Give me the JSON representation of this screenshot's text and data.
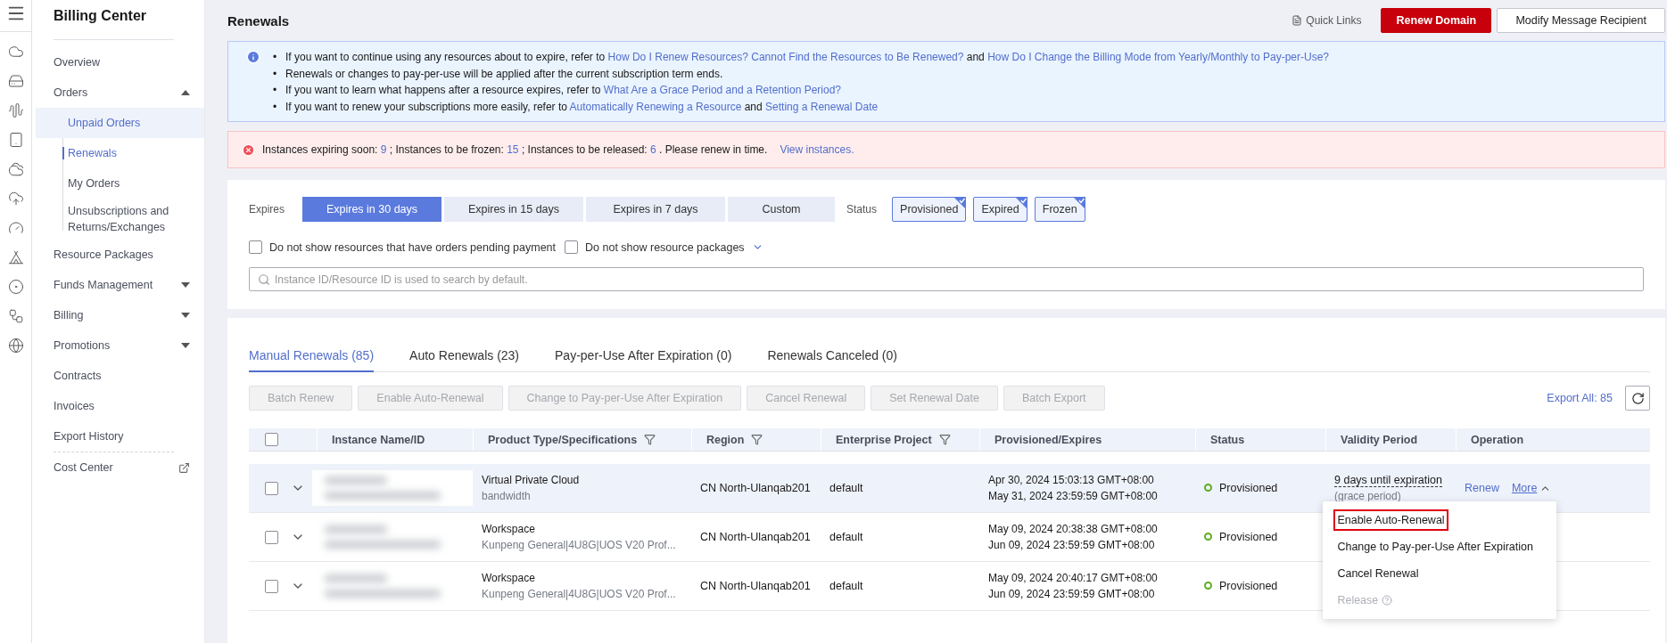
{
  "sidebar": {
    "title": "Billing Center",
    "items": [
      {
        "label": "Overview",
        "kind": "link"
      },
      {
        "label": "Orders",
        "kind": "group",
        "expanded": true,
        "children": [
          {
            "label": "Unpaid Orders",
            "selected": false,
            "hovered": true
          },
          {
            "label": "Renewals",
            "selected": true,
            "hovered": false
          },
          {
            "label": "My Orders",
            "selected": false,
            "hovered": false
          },
          {
            "label": "Unsubscriptions and Returns/Exchanges",
            "selected": false,
            "hovered": false
          }
        ]
      },
      {
        "label": "Resource Packages",
        "kind": "link"
      },
      {
        "label": "Funds Management",
        "kind": "group",
        "expanded": false
      },
      {
        "label": "Billing",
        "kind": "group",
        "expanded": false
      },
      {
        "label": "Promotions",
        "kind": "group",
        "expanded": false
      },
      {
        "label": "Contracts",
        "kind": "link"
      },
      {
        "label": "Invoices",
        "kind": "link"
      },
      {
        "label": "Export History",
        "kind": "link"
      },
      {
        "label": "Cost Center",
        "kind": "external"
      }
    ]
  },
  "page": {
    "title": "Renewals",
    "quick_links": "Quick Links",
    "buttons": [
      {
        "label": "Renew Domain",
        "kind": "primary"
      },
      {
        "label": "Modify Message Recipient",
        "kind": "default"
      }
    ]
  },
  "info": {
    "items": [
      {
        "marker": "•",
        "parts": [
          {
            "text": "If you want to continue using any resources about to expire, refer to ",
            "kind": "text"
          },
          {
            "text": "How Do I Renew Resources? Cannot Find the Resources to Be Renewed?",
            "kind": "link"
          },
          {
            "text": " and ",
            "kind": "text"
          },
          {
            "text": "How Do I Change the Billing Mode from Yearly/Monthly to Pay-per-Use?",
            "kind": "link"
          }
        ]
      },
      {
        "marker": "•",
        "parts": [
          {
            "text": "Renewals or changes to pay-per-use will be applied after the current subscription term ends.",
            "kind": "text"
          }
        ]
      },
      {
        "marker": "•",
        "parts": [
          {
            "text": "If you want to learn what happens after a resource expires, refer to ",
            "kind": "text"
          },
          {
            "text": "What Are a Grace Period and a Retention Period?",
            "kind": "link"
          }
        ]
      },
      {
        "marker": "•",
        "parts": [
          {
            "text": "If you want to renew your subscriptions more easily, refer to ",
            "kind": "text"
          },
          {
            "text": "Automatically Renewing a Resource",
            "kind": "link"
          },
          {
            "text": " and ",
            "kind": "text"
          },
          {
            "text": "Setting a Renewal Date",
            "kind": "link"
          }
        ]
      }
    ]
  },
  "alert": {
    "parts": [
      {
        "text": "Instances expiring soon: ",
        "kind": "text"
      },
      {
        "text": "9",
        "kind": "link"
      },
      {
        "text": " ; Instances to be frozen: ",
        "kind": "text"
      },
      {
        "text": "15",
        "kind": "link"
      },
      {
        "text": " ; Instances to be released: ",
        "kind": "text"
      },
      {
        "text": "6",
        "kind": "link"
      },
      {
        "text": " . Please renew in time.",
        "kind": "text"
      },
      {
        "text": "View instances.",
        "kind": "link"
      }
    ]
  },
  "filters": {
    "expires_label": "Expires",
    "expires_options": [
      {
        "label": "Expires in 30 days",
        "selected": true
      },
      {
        "label": "Expires in 15 days",
        "selected": false
      },
      {
        "label": "Expires in 7 days",
        "selected": false
      },
      {
        "label": "Custom",
        "selected": false
      }
    ],
    "status_label": "Status",
    "status_options": [
      {
        "label": "Provisioned",
        "checked": true
      },
      {
        "label": "Expired",
        "checked": true
      },
      {
        "label": "Frozen",
        "checked": true
      }
    ],
    "checkboxes": [
      {
        "label": "Do not show resources that have orders pending payment",
        "checked": false,
        "kind": "plain"
      },
      {
        "label": "Do not show resource packages",
        "checked": false,
        "kind": "dropdown"
      }
    ],
    "search": {
      "placeholder": "Instance ID/Resource ID is used to search by default."
    }
  },
  "tabs": [
    {
      "label": "Manual Renewals (85)",
      "selected": true
    },
    {
      "label": "Auto Renewals (23)",
      "selected": false
    },
    {
      "label": "Pay-per-Use After Expiration (0)",
      "selected": false
    },
    {
      "label": "Renewals Canceled (0)",
      "selected": false
    }
  ],
  "actions": [
    {
      "label": "Batch Renew",
      "disabled": true
    },
    {
      "label": "Enable Auto-Renewal",
      "disabled": true
    },
    {
      "label": "Change to Pay-per-Use After Expiration",
      "disabled": true
    },
    {
      "label": "Cancel Renewal",
      "disabled": true
    },
    {
      "label": "Set Renewal Date",
      "disabled": true
    },
    {
      "label": "Batch Export",
      "disabled": true
    }
  ],
  "export_all": "Export All: 85",
  "table": {
    "header_checked": false,
    "columns": [
      {
        "label": "Instance Name/ID",
        "filter": false
      },
      {
        "label": "Product Type/Specifications",
        "filter": true
      },
      {
        "label": "Region",
        "filter": true
      },
      {
        "label": "Enterprise Project",
        "filter": true
      },
      {
        "label": "Provisioned/Expires",
        "filter": false
      },
      {
        "label": "Status",
        "filter": false
      },
      {
        "label": "Validity Period",
        "filter": false
      },
      {
        "label": "Operation",
        "filter": false
      }
    ],
    "rows": [
      {
        "checked": false,
        "expanded": false,
        "hovered": true,
        "product": "Virtual Private Cloud",
        "spec": "bandwidth",
        "region": "CN North-Ulanqab201",
        "project": "default",
        "provisioned": "Apr 30, 2024 15:03:13 GMT+08:00",
        "expires": "May 31, 2024 23:59:59 GMT+08:00",
        "status": "Provisioned",
        "validity": "9 days until expiration",
        "validity_note": "(grace period)",
        "operations": [
          {
            "label": "Renew",
            "kind": "link"
          },
          {
            "label": "More",
            "kind": "menu",
            "expanded": true,
            "items": [
              {
                "label": "Enable Auto-Renewal",
                "disabled": false,
                "outlined": true
              },
              {
                "label": "Change to Pay-per-Use After Expiration",
                "disabled": false,
                "outlined": false
              },
              {
                "label": "Cancel Renewal",
                "disabled": false,
                "outlined": false
              },
              {
                "label": "Release",
                "disabled": true,
                "outlined": false,
                "help": true
              }
            ]
          }
        ]
      },
      {
        "checked": false,
        "expanded": false,
        "hovered": false,
        "product": "Workspace",
        "spec": "Kunpeng General|4U8G|UOS V20 Prof...",
        "region": "CN North-Ulanqab201",
        "project": "default",
        "provisioned": "May 09, 2024 20:38:38 GMT+08:00",
        "expires": "Jun 09, 2024 23:59:59 GMT+08:00",
        "status": "Provisioned"
      },
      {
        "checked": false,
        "expanded": false,
        "hovered": false,
        "product": "Workspace",
        "spec": "Kunpeng General|4U8G|UOS V20 Prof...",
        "region": "CN North-Ulanqab201",
        "project": "default",
        "provisioned": "May 09, 2024 20:40:17 GMT+08:00",
        "expires": "Jun 09, 2024 23:59:59 GMT+08:00",
        "status": "Provisioned"
      }
    ]
  }
}
